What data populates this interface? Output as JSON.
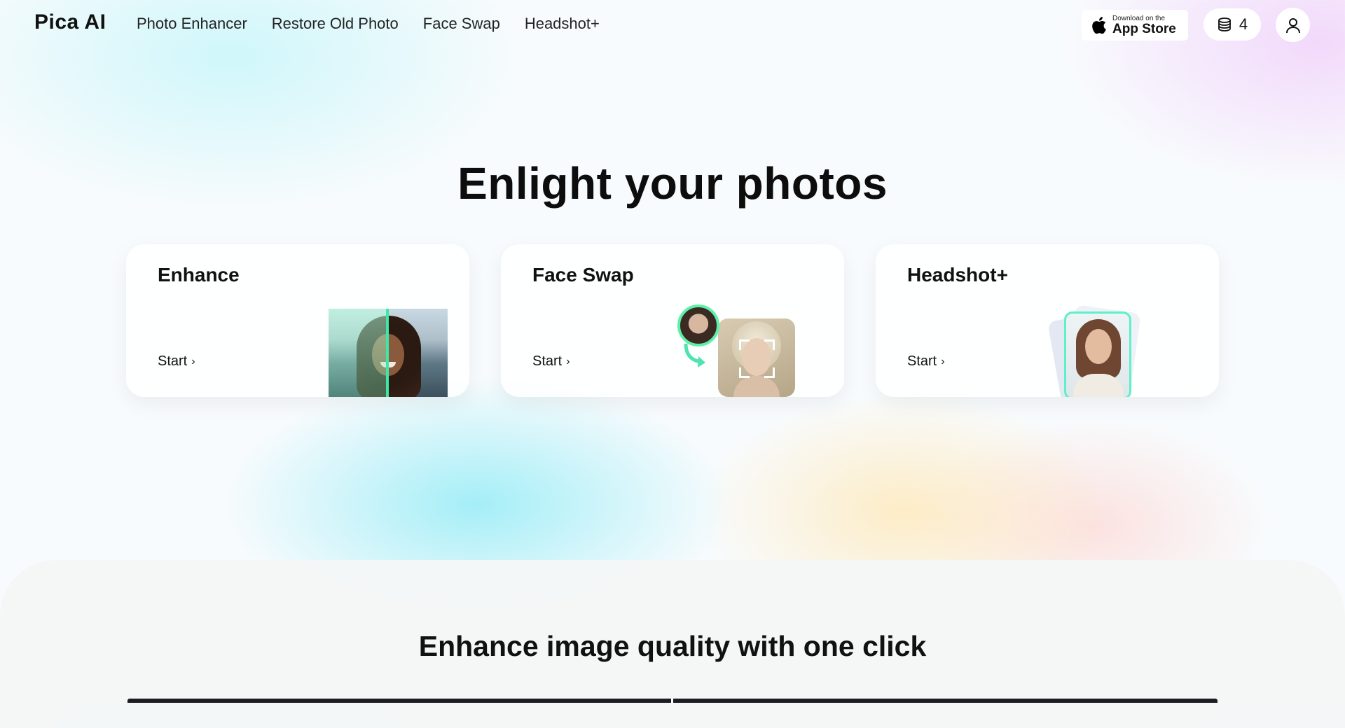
{
  "header": {
    "logo": "Pica AI",
    "nav": [
      "Photo Enhancer",
      "Restore Old Photo",
      "Face Swap",
      "Headshot+"
    ],
    "app_store": {
      "small": "Download on the",
      "big": "App Store",
      "icon": "apple-icon"
    },
    "credits": {
      "count": "4",
      "icon": "coins-stack-icon"
    },
    "user_icon": "user-icon"
  },
  "hero": {
    "title": "Enlight your photos",
    "cards": [
      {
        "title": "Enhance",
        "cta": "Start"
      },
      {
        "title": "Face Swap",
        "cta": "Start"
      },
      {
        "title": "Headshot+",
        "cta": "Start"
      }
    ]
  },
  "section2": {
    "title": "Enhance image quality with one click"
  },
  "colors": {
    "accent": "#3ee6a7",
    "text": "#111111"
  }
}
